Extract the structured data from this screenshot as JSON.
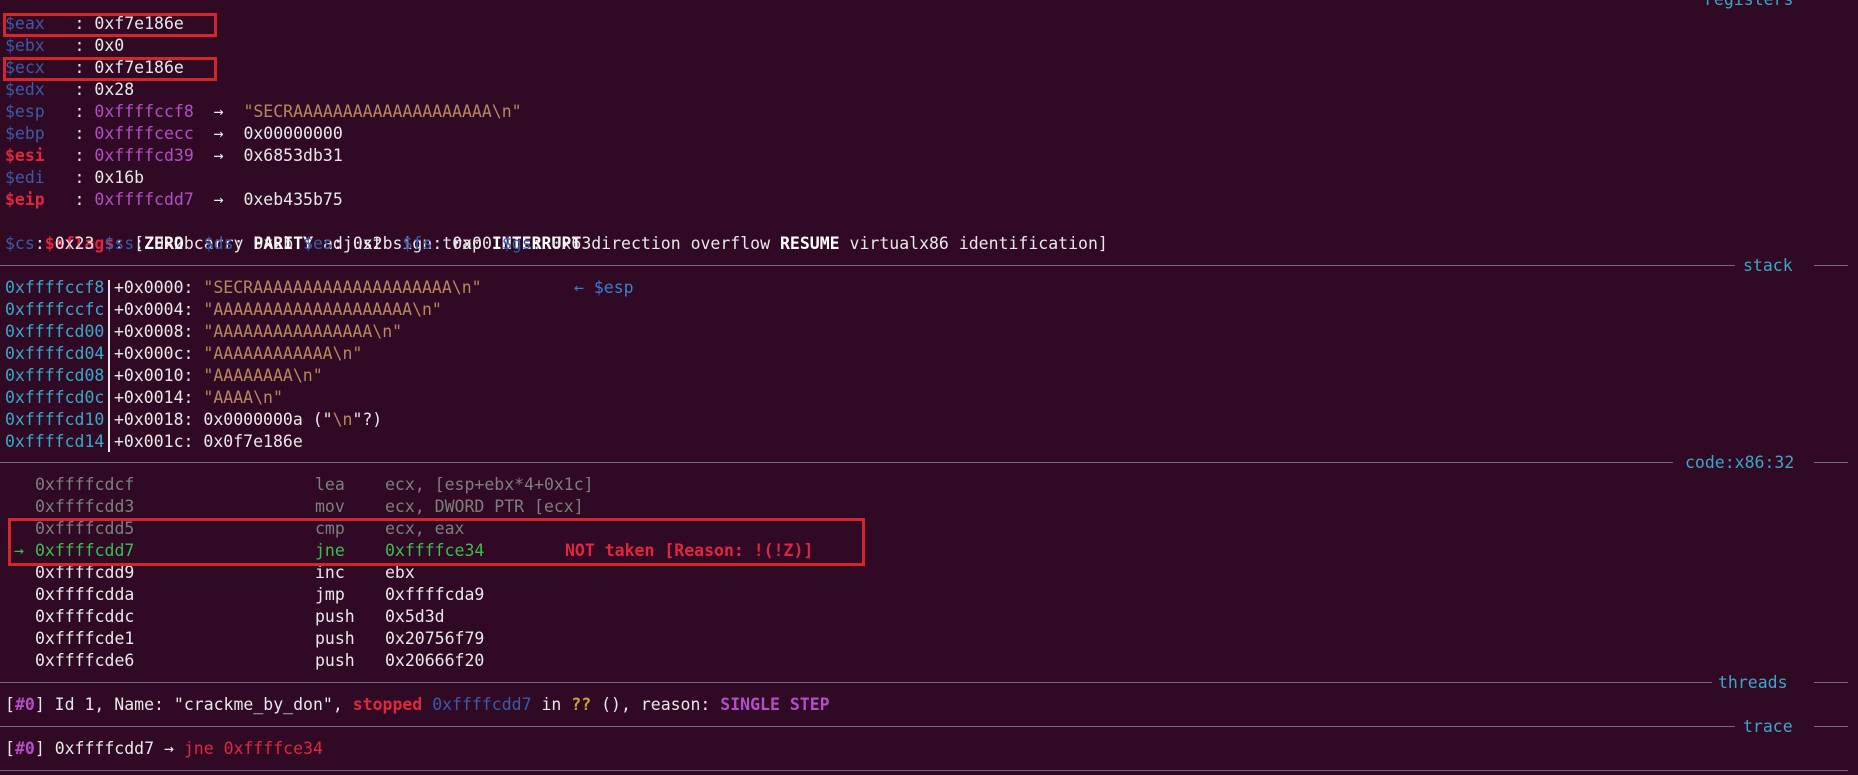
{
  "sections": {
    "registers": "registers",
    "stack": "stack",
    "code": "code:x86:32",
    "threads": "threads",
    "trace": "trace"
  },
  "registers": [
    {
      "name": "$eax",
      "sep": "   : ",
      "value": "0xf7e186e"
    },
    {
      "name": "$ebx",
      "sep": "   : ",
      "value": "0x0"
    },
    {
      "name": "$ecx",
      "sep": "   : ",
      "value": "0xf7e186e"
    },
    {
      "name": "$edx",
      "sep": "   : ",
      "value": "0x28"
    },
    {
      "name": "$esp",
      "sep": "   : ",
      "value": "0xffffccf8",
      "arrow": "  →  ",
      "target": "\"SECRAAAAAAAAAAAAAAAAAAAA\\n\""
    },
    {
      "name": "$ebp",
      "sep": "   : ",
      "value": "0xffffcecc",
      "arrow": "  →  ",
      "target": "0x00000000"
    },
    {
      "name": "$esi",
      "sep": "   : ",
      "value": "0xffffcd39",
      "arrow": "  →  ",
      "target": "0x6853db31"
    },
    {
      "name": "$edi",
      "sep": "   : ",
      "value": "0x16b"
    },
    {
      "name": "$eip",
      "sep": "   : ",
      "value": "0xffffcdd7",
      "arrow": "  →  ",
      "target": "0xeb435b75"
    }
  ],
  "eflags": {
    "name": "$eflags",
    "prefix": ": [",
    "flags": [
      {
        "text": "ZERO",
        "set": true
      },
      {
        "text": "carry",
        "set": false
      },
      {
        "text": "PARITY",
        "set": true
      },
      {
        "text": "adjust",
        "set": false
      },
      {
        "text": "sign",
        "set": false
      },
      {
        "text": "trap",
        "set": false
      },
      {
        "text": "INTERRUPT",
        "set": true
      },
      {
        "text": "direction",
        "set": false
      },
      {
        "text": "overflow",
        "set": false
      },
      {
        "text": "RESUME",
        "set": true
      },
      {
        "text": "virtualx86",
        "set": false
      },
      {
        "text": "identification",
        "set": false
      }
    ],
    "suffix": "]"
  },
  "segments": [
    {
      "name": "$cs",
      "value": "0x23"
    },
    {
      "name": "$ss",
      "value": "0x2b"
    },
    {
      "name": "$ds",
      "value": "0x2b"
    },
    {
      "name": "$es",
      "value": "0x2b"
    },
    {
      "name": "$fs",
      "value": "0x00"
    },
    {
      "name": "$gs",
      "value": "0x63"
    }
  ],
  "stack": {
    "esp_marker": "← $esp",
    "rows": [
      {
        "addr": "0xffffccf8",
        "offset": "+0x0000:",
        "value": "\"SECRAAAAAAAAAAAAAAAAAAAA\\n\"",
        "kind": "str"
      },
      {
        "addr": "0xffffccfc",
        "offset": "+0x0004:",
        "value": "\"AAAAAAAAAAAAAAAAAAAA\\n\"",
        "kind": "str"
      },
      {
        "addr": "0xffffcd00",
        "offset": "+0x0008:",
        "value": "\"AAAAAAAAAAAAAAAA\\n\"",
        "kind": "str"
      },
      {
        "addr": "0xffffcd04",
        "offset": "+0x000c:",
        "value": "\"AAAAAAAAAAAA\\n\"",
        "kind": "str"
      },
      {
        "addr": "0xffffcd08",
        "offset": "+0x0010:",
        "value": "\"AAAAAAAA\\n\"",
        "kind": "str"
      },
      {
        "addr": "0xffffcd0c",
        "offset": "+0x0014:",
        "value": "\"AAAA\\n\"",
        "kind": "str"
      },
      {
        "addr": "0xffffcd10",
        "offset": "+0x0018:",
        "value": "0x0000000a (\"\\n\"?)",
        "kind": "mixed",
        "plain1": "0x0000000a (\"",
        "strpart": "\\n",
        "plain2": "\"?)"
      },
      {
        "addr": "0xffffcd14",
        "offset": "+0x001c:",
        "value": "0x0f7e186e",
        "kind": "plain"
      }
    ]
  },
  "code": [
    {
      "marker": "",
      "addr": "0xffffcdcf",
      "mnemonic": "lea",
      "operands": "ecx, [esp+ebx*4+0x1c]",
      "state": "past"
    },
    {
      "marker": "",
      "addr": "0xffffcdd3",
      "mnemonic": "mov",
      "operands": "ecx, DWORD PTR [ecx]",
      "state": "past"
    },
    {
      "marker": "",
      "addr": "0xffffcdd5",
      "mnemonic": "cmp",
      "operands": "ecx, eax",
      "state": "past"
    },
    {
      "marker": "→",
      "addr": "0xffffcdd7",
      "mnemonic": "jne",
      "operands": "0xffffce34",
      "state": "current",
      "note": "NOT taken [Reason: !(!Z)]"
    },
    {
      "marker": "",
      "addr": "0xffffcdd9",
      "mnemonic": "inc",
      "operands": "ebx",
      "state": "next"
    },
    {
      "marker": "",
      "addr": "0xffffcdda",
      "mnemonic": "jmp",
      "operands": "0xffffcda9",
      "state": "next"
    },
    {
      "marker": "",
      "addr": "0xffffcddc",
      "mnemonic": "push",
      "operands": "0x5d3d",
      "state": "next"
    },
    {
      "marker": "",
      "addr": "0xffffcde1",
      "mnemonic": "push",
      "operands": "0x20756f79",
      "state": "next"
    },
    {
      "marker": "",
      "addr": "0xffffcde6",
      "mnemonic": "push",
      "operands": "0x20666f20",
      "state": "next"
    }
  ],
  "threads": {
    "idx": "#0",
    "text1": " Id 1, Name: \"crackme_by_don\", ",
    "status": "stopped",
    "addr": "0xffffcdd7",
    "in": " in ",
    "func": "??",
    "text2": " (), reason: ",
    "reason": "SINGLE STEP"
  },
  "trace": {
    "idx": "#0",
    "addr": "0xffffcdd7",
    "arrow": " → ",
    "instr": "jne 0xffffce34"
  }
}
